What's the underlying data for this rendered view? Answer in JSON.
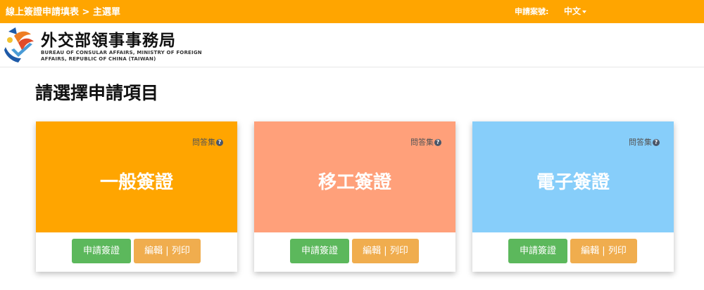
{
  "header": {
    "breadcrumb": "線上簽證申請填表 > 主選單",
    "application_no_label": "申請案號:",
    "language": "中文"
  },
  "org": {
    "name_zh": "外交部領事事務局",
    "name_en_line1": "BUREAU OF CONSULAR AFFAIRS, MINISTRY OF FOREIGN",
    "name_en_line2": "AFFAIRS, REPUBLIC OF CHINA (TAIWAN)"
  },
  "page": {
    "title": "請選擇申請項目"
  },
  "cards": [
    {
      "title": "一般簽證",
      "faq": "問答集",
      "apply_label": "申請簽證",
      "edit_label": "編輯 | 列印",
      "color": "#ffa500"
    },
    {
      "title": "移工簽證",
      "faq": "問答集",
      "apply_label": "申請簽證",
      "edit_label": "編輯 | 列印",
      "color": "#ffa07a"
    },
    {
      "title": "電子簽證",
      "faq": "問答集",
      "apply_label": "申請簽證",
      "edit_label": "編輯 | 列印",
      "color": "#87cefa"
    }
  ],
  "colors": {
    "topbar": "#ffa500",
    "apply_button": "#5cb85c",
    "edit_button": "#f0ad4e"
  }
}
